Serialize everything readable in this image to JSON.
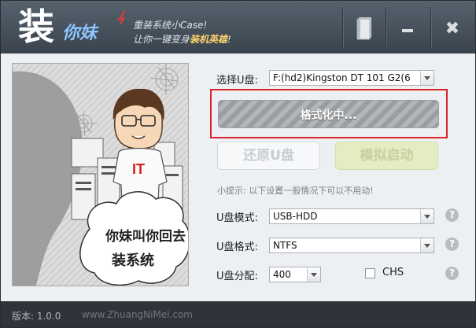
{
  "title": {
    "logo_main": "装",
    "logo_sub": "你妹",
    "slogan_line1": "重装系统小Case!",
    "slogan_line2_prefix": "让你一键变身",
    "slogan_line2_highlight": "装机英雄",
    "slogan_line2_suffix": "!",
    "close_glyph": "✖",
    "minimize_glyph": "—"
  },
  "illustration": {
    "shirt_text": "IT",
    "bubble_line1": "你妹叫你回去",
    "bubble_line2": "装系统"
  },
  "form": {
    "select_disk_label": "选择U盘:",
    "select_disk_value": "F:(hd2)Kingston DT 101 G2(6",
    "progress_text": "格式化中...",
    "restore_button": "还原U盘",
    "simulate_button": "模拟启动",
    "tip": "小提示: 以下设置一般情况下可以不用动!",
    "mode_label": "U盘模式:",
    "mode_value": "USB-HDD",
    "format_label": "U盘格式:",
    "format_value": "NTFS",
    "partition_label": "U盘分配:",
    "partition_value": "400",
    "chs_label": "CHS",
    "help_glyph": "?"
  },
  "footer": {
    "version": "版本: 1.0.0",
    "website": "www.ZhuangNiMei.com"
  },
  "colors": {
    "titlebar": "#46505a",
    "highlight_frame": "#d8242a",
    "simulate_button": "#e6ecc1"
  }
}
